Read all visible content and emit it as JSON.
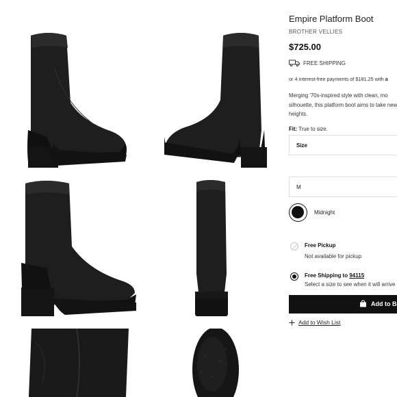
{
  "gallery": {
    "images": [
      {
        "name": "left side view"
      },
      {
        "name": "right side view"
      },
      {
        "name": "three-quarter view"
      },
      {
        "name": "back view"
      },
      {
        "name": "close-up shaft"
      },
      {
        "name": "sole detail"
      }
    ]
  },
  "product": {
    "title": "Empire Platform Boot",
    "brand": "BROTHER VELLIES",
    "price": "$725.00",
    "shipping_badge": "FREE SHIPPING",
    "installments_text": "or 4 interest-free payments of $181.25 with",
    "installments_brand": "a",
    "description": "Merging '70s-inspired style with clean, mo silhouette, this platform boot aims to take new heights.",
    "fit_label": "Fit:",
    "fit_value": "True to size.",
    "size_select_label": "Size",
    "size_value": "M",
    "color_name": "Midnight"
  },
  "fulfillment": {
    "pickup_title": "Free Pickup",
    "pickup_sub": "Not available for pickup",
    "ship_title": "Free Shipping to",
    "ship_zip": "94115",
    "ship_sub": "Select a size to see when it will arrive"
  },
  "actions": {
    "add_to_bag": "Add to Ba",
    "wish_list": "Add to Wish List"
  },
  "icons": {
    "truck": "truck-icon",
    "bag": "shopping-bag-icon",
    "plus": "plus-icon"
  },
  "colors": {
    "button_bg": "#111111",
    "boot_leather": "#1c1c1c",
    "sole": "#161616"
  }
}
